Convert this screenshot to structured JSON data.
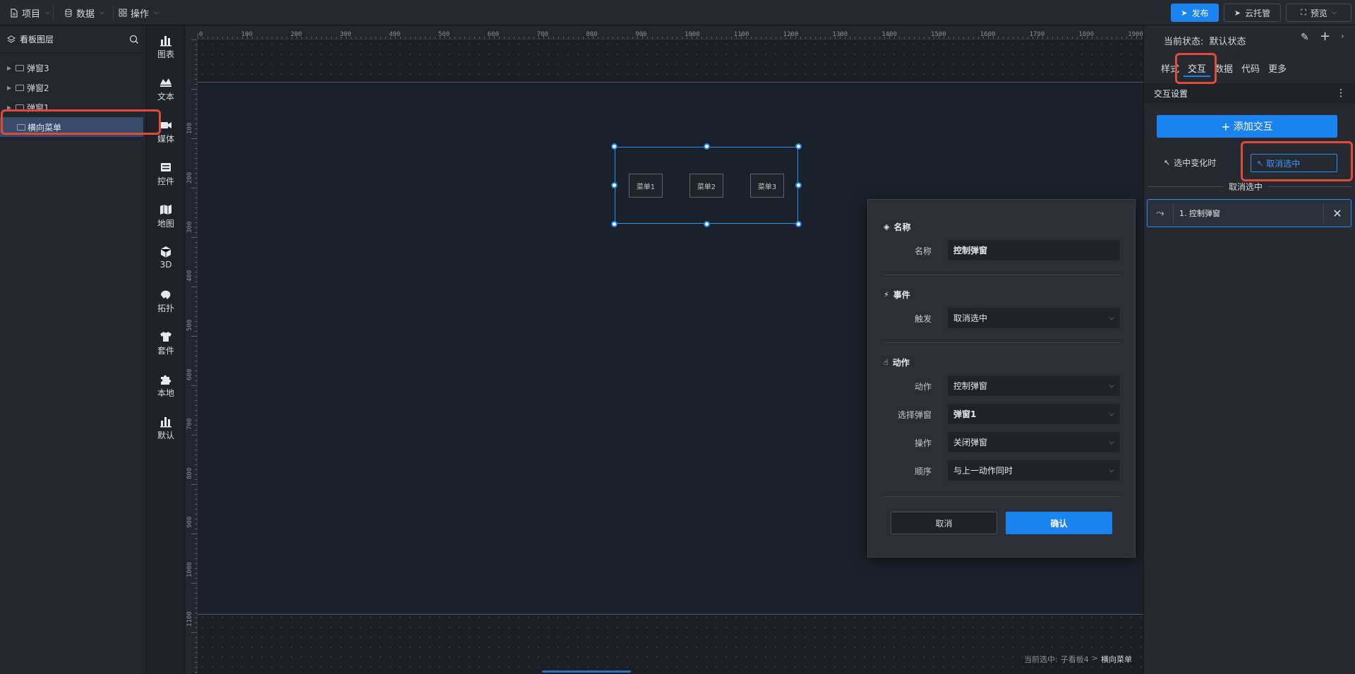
{
  "topbar": {
    "menus": [
      {
        "label": "项目",
        "icon": "file-icon"
      },
      {
        "label": "数据",
        "icon": "database-icon"
      },
      {
        "label": "操作",
        "icon": "grid-icon"
      }
    ],
    "publish_label": "发布",
    "cloud_label": "云托管",
    "preview_label": "预览"
  },
  "layers": {
    "title": "看板图层",
    "items": [
      {
        "label": "弹窗3"
      },
      {
        "label": "弹窗2"
      },
      {
        "label": "弹窗1"
      },
      {
        "label": "横向菜单"
      }
    ]
  },
  "components": [
    {
      "label": "图表",
      "icon": "chart-icon"
    },
    {
      "label": "文本",
      "icon": "text-icon"
    },
    {
      "label": "媒体",
      "icon": "media-icon"
    },
    {
      "label": "控件",
      "icon": "control-icon"
    },
    {
      "label": "地图",
      "icon": "map-icon"
    },
    {
      "label": "3D",
      "icon": "cube-icon"
    },
    {
      "label": "拓扑",
      "icon": "topology-icon"
    },
    {
      "label": "套件",
      "icon": "shirt-icon"
    },
    {
      "label": "本地",
      "icon": "puzzle-icon"
    },
    {
      "label": "默认",
      "icon": "bars-icon"
    }
  ],
  "ruler": {
    "top": [
      "0",
      "100",
      "200",
      "300",
      "400",
      "500",
      "600",
      "700",
      "800",
      "900",
      "1000",
      "1100",
      "1200",
      "1300",
      "1400",
      "1500",
      "1600",
      "1700",
      "1800",
      "1900"
    ],
    "left": [
      "100",
      "200",
      "300",
      "400",
      "500",
      "600",
      "700",
      "800",
      "900",
      "1000",
      "1100"
    ]
  },
  "canvas": {
    "menu_items": [
      "菜单1",
      "菜单2",
      "菜单3"
    ],
    "status_prefix": "当前选中:",
    "status_path": "子看板4",
    "status_sep": ">",
    "status_current": "横向菜单"
  },
  "dialog": {
    "name_section": "名称",
    "name_label": "名称",
    "name_value": "控制弹窗",
    "event_section": "事件",
    "trigger_label": "触发",
    "trigger_value": "取消选中",
    "action_section": "动作",
    "action_label": "动作",
    "action_value": "控制弹窗",
    "popup_label": "选择弹窗",
    "popup_value": "弹窗1",
    "op_label": "操作",
    "op_value": "关闭弹窗",
    "order_label": "顺序",
    "order_value": "与上一动作同时",
    "cancel_label": "取消",
    "confirm_label": "确认"
  },
  "right_panel": {
    "state_label": "当前状态:",
    "state_value": "默认状态",
    "tabs": [
      "样式",
      "交互",
      "数据",
      "代码",
      "更多"
    ],
    "active_tab": "交互",
    "section_title": "交互设置",
    "add_label": "添加交互",
    "event_label": "选中变化时",
    "event_tag": "取消选中",
    "group_title": "取消选中",
    "action_item": "1. 控制弹窗"
  },
  "colors": {
    "accent": "#1b83f0",
    "highlight": "#e04a3a"
  }
}
